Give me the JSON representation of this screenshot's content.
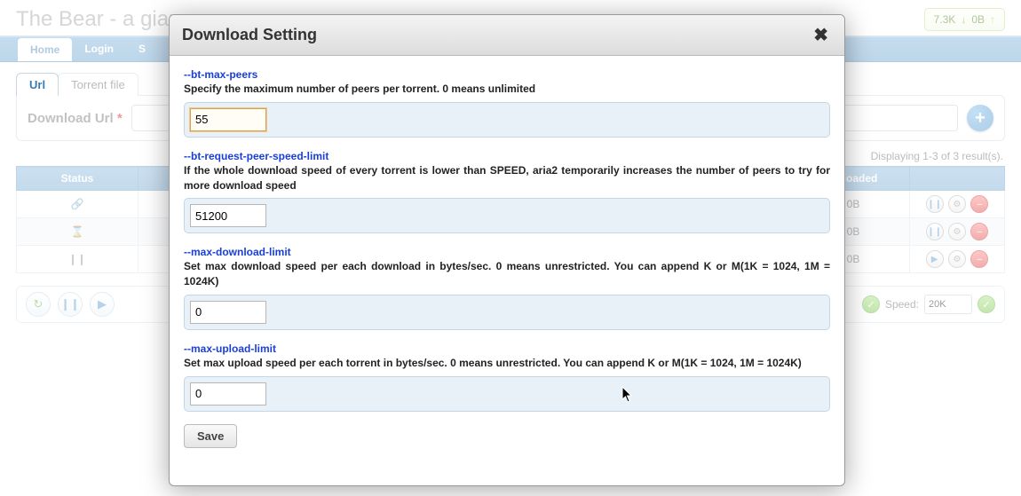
{
  "header": {
    "title": "The Bear - a gian",
    "down_speed": "7.3K",
    "up_speed": "0B"
  },
  "nav": {
    "items": [
      "Home",
      "Login",
      "S"
    ],
    "active_index": 0
  },
  "tabs": {
    "items": [
      "Url",
      "Torrent file"
    ],
    "active_index": 0
  },
  "url_form": {
    "label": "Download Url",
    "required_mark": "*",
    "value": ""
  },
  "display_text": "Displaying 1-3 of 3 result(s).",
  "grid": {
    "headers": [
      "Status",
      "Uploaded",
      ""
    ],
    "rows": [
      {
        "status_icon": "link",
        "uploaded": "0B",
        "actions": "pause-gear-stop"
      },
      {
        "status_icon": "wait",
        "uploaded": "0B",
        "actions": "pause-gear-stop"
      },
      {
        "status_icon": "paused",
        "uploaded": "0B",
        "actions": "play-gear-stop"
      }
    ]
  },
  "footer": {
    "speed_label": "Speed:",
    "speed_value": "20K"
  },
  "modal": {
    "title": "Download Setting",
    "settings": [
      {
        "key": "--bt-max-peers",
        "desc": "Specify the maximum number of peers per torrent. 0 means unlimited",
        "value": "55",
        "hl": true
      },
      {
        "key": "--bt-request-peer-speed-limit",
        "desc": "If the whole download speed of every torrent is lower than SPEED, aria2 temporarily increases the number of peers to try for more download speed",
        "value": "51200",
        "hl": false
      },
      {
        "key": "--max-download-limit",
        "desc": "Set max download speed per each download in bytes/sec. 0 means unrestricted. You can append K or M(1K = 1024, 1M = 1024K)",
        "value": "0",
        "hl": false
      },
      {
        "key": "--max-upload-limit",
        "desc": "Set max upload speed per each torrent in bytes/sec. 0 means unrestricted. You can append K or M(1K = 1024, 1M = 1024K)",
        "value": "0",
        "hl": false
      }
    ],
    "save_label": "Save"
  }
}
